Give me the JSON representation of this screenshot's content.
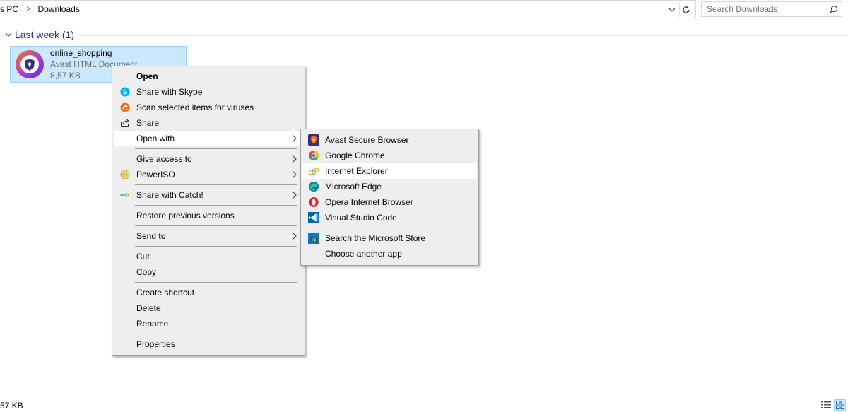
{
  "address_bar": {
    "crumbs": [
      "s PC",
      "Downloads"
    ]
  },
  "search": {
    "placeholder": "Search Downloads"
  },
  "group": {
    "title": "Last week (1)"
  },
  "file": {
    "name": "online_shopping",
    "type": "Avast HTML Document",
    "size": "8,57 KB"
  },
  "context_menu": {
    "items": [
      {
        "label": "Open",
        "icon": "none"
      },
      {
        "label": "Share with Skype",
        "icon": "skype-icon"
      },
      {
        "label": "Scan selected items for viruses",
        "icon": "avast-scan-icon"
      },
      {
        "label": "Share",
        "icon": "share-icon"
      },
      {
        "label": "Open with",
        "icon": "none"
      },
      {
        "label": "Give access to",
        "icon": "none"
      },
      {
        "label": "PowerISO",
        "icon": "poweriso-icon"
      },
      {
        "label": "Share with Catch!",
        "icon": "catch-icon"
      },
      {
        "label": "Restore previous versions",
        "icon": "none"
      },
      {
        "label": "Send to",
        "icon": "none"
      },
      {
        "label": "Cut",
        "icon": "none"
      },
      {
        "label": "Copy",
        "icon": "none"
      },
      {
        "label": "Create shortcut",
        "icon": "none"
      },
      {
        "label": "Delete",
        "icon": "none"
      },
      {
        "label": "Rename",
        "icon": "none"
      },
      {
        "label": "Properties",
        "icon": "none"
      }
    ]
  },
  "open_with_menu": {
    "items": [
      {
        "label": "Avast Secure Browser",
        "icon": "avast-browser-icon"
      },
      {
        "label": "Google Chrome",
        "icon": "chrome-icon"
      },
      {
        "label": "Internet Explorer",
        "icon": "internet-explorer-icon"
      },
      {
        "label": "Microsoft Edge",
        "icon": "edge-icon"
      },
      {
        "label": "Opera Internet Browser",
        "icon": "opera-icon"
      },
      {
        "label": "Visual Studio Code",
        "icon": "vscode-icon"
      },
      {
        "label": "Search the Microsoft Store",
        "icon": "store-icon"
      },
      {
        "label": "Choose another app",
        "icon": "none"
      }
    ]
  },
  "status_bar": {
    "selection": "57 KB"
  },
  "colors": {
    "selection_bg": "#cce8ff",
    "selection_border": "#99d1ff",
    "group_title": "#1e3287",
    "menu_bg": "#eeeeee",
    "menu_hover": "#ffffff"
  }
}
